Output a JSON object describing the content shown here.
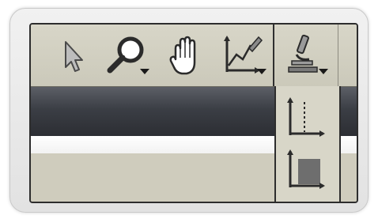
{
  "toolbar": {
    "tools": [
      {
        "name": "select",
        "icon": "arrow-pointer-icon"
      },
      {
        "name": "zoom",
        "icon": "magnifier-icon",
        "has_dropdown": true
      },
      {
        "name": "pan",
        "icon": "hand-icon"
      },
      {
        "name": "plot",
        "icon": "line-graph-icon",
        "has_dropdown": true
      },
      {
        "name": "measure",
        "icon": "microscope-icon",
        "has_dropdown": true,
        "active": true
      }
    ]
  },
  "dropdown_menu": {
    "items": [
      {
        "icon": "axis-dashed-line-icon"
      },
      {
        "icon": "axis-filled-area-icon"
      }
    ]
  },
  "colors": {
    "toolbar": "#cbc9ba",
    "titlebar": "#3b3e45",
    "border": "#2d2d2d",
    "icon": "#2b2b2b",
    "area_fill": "#6e6e6e"
  }
}
